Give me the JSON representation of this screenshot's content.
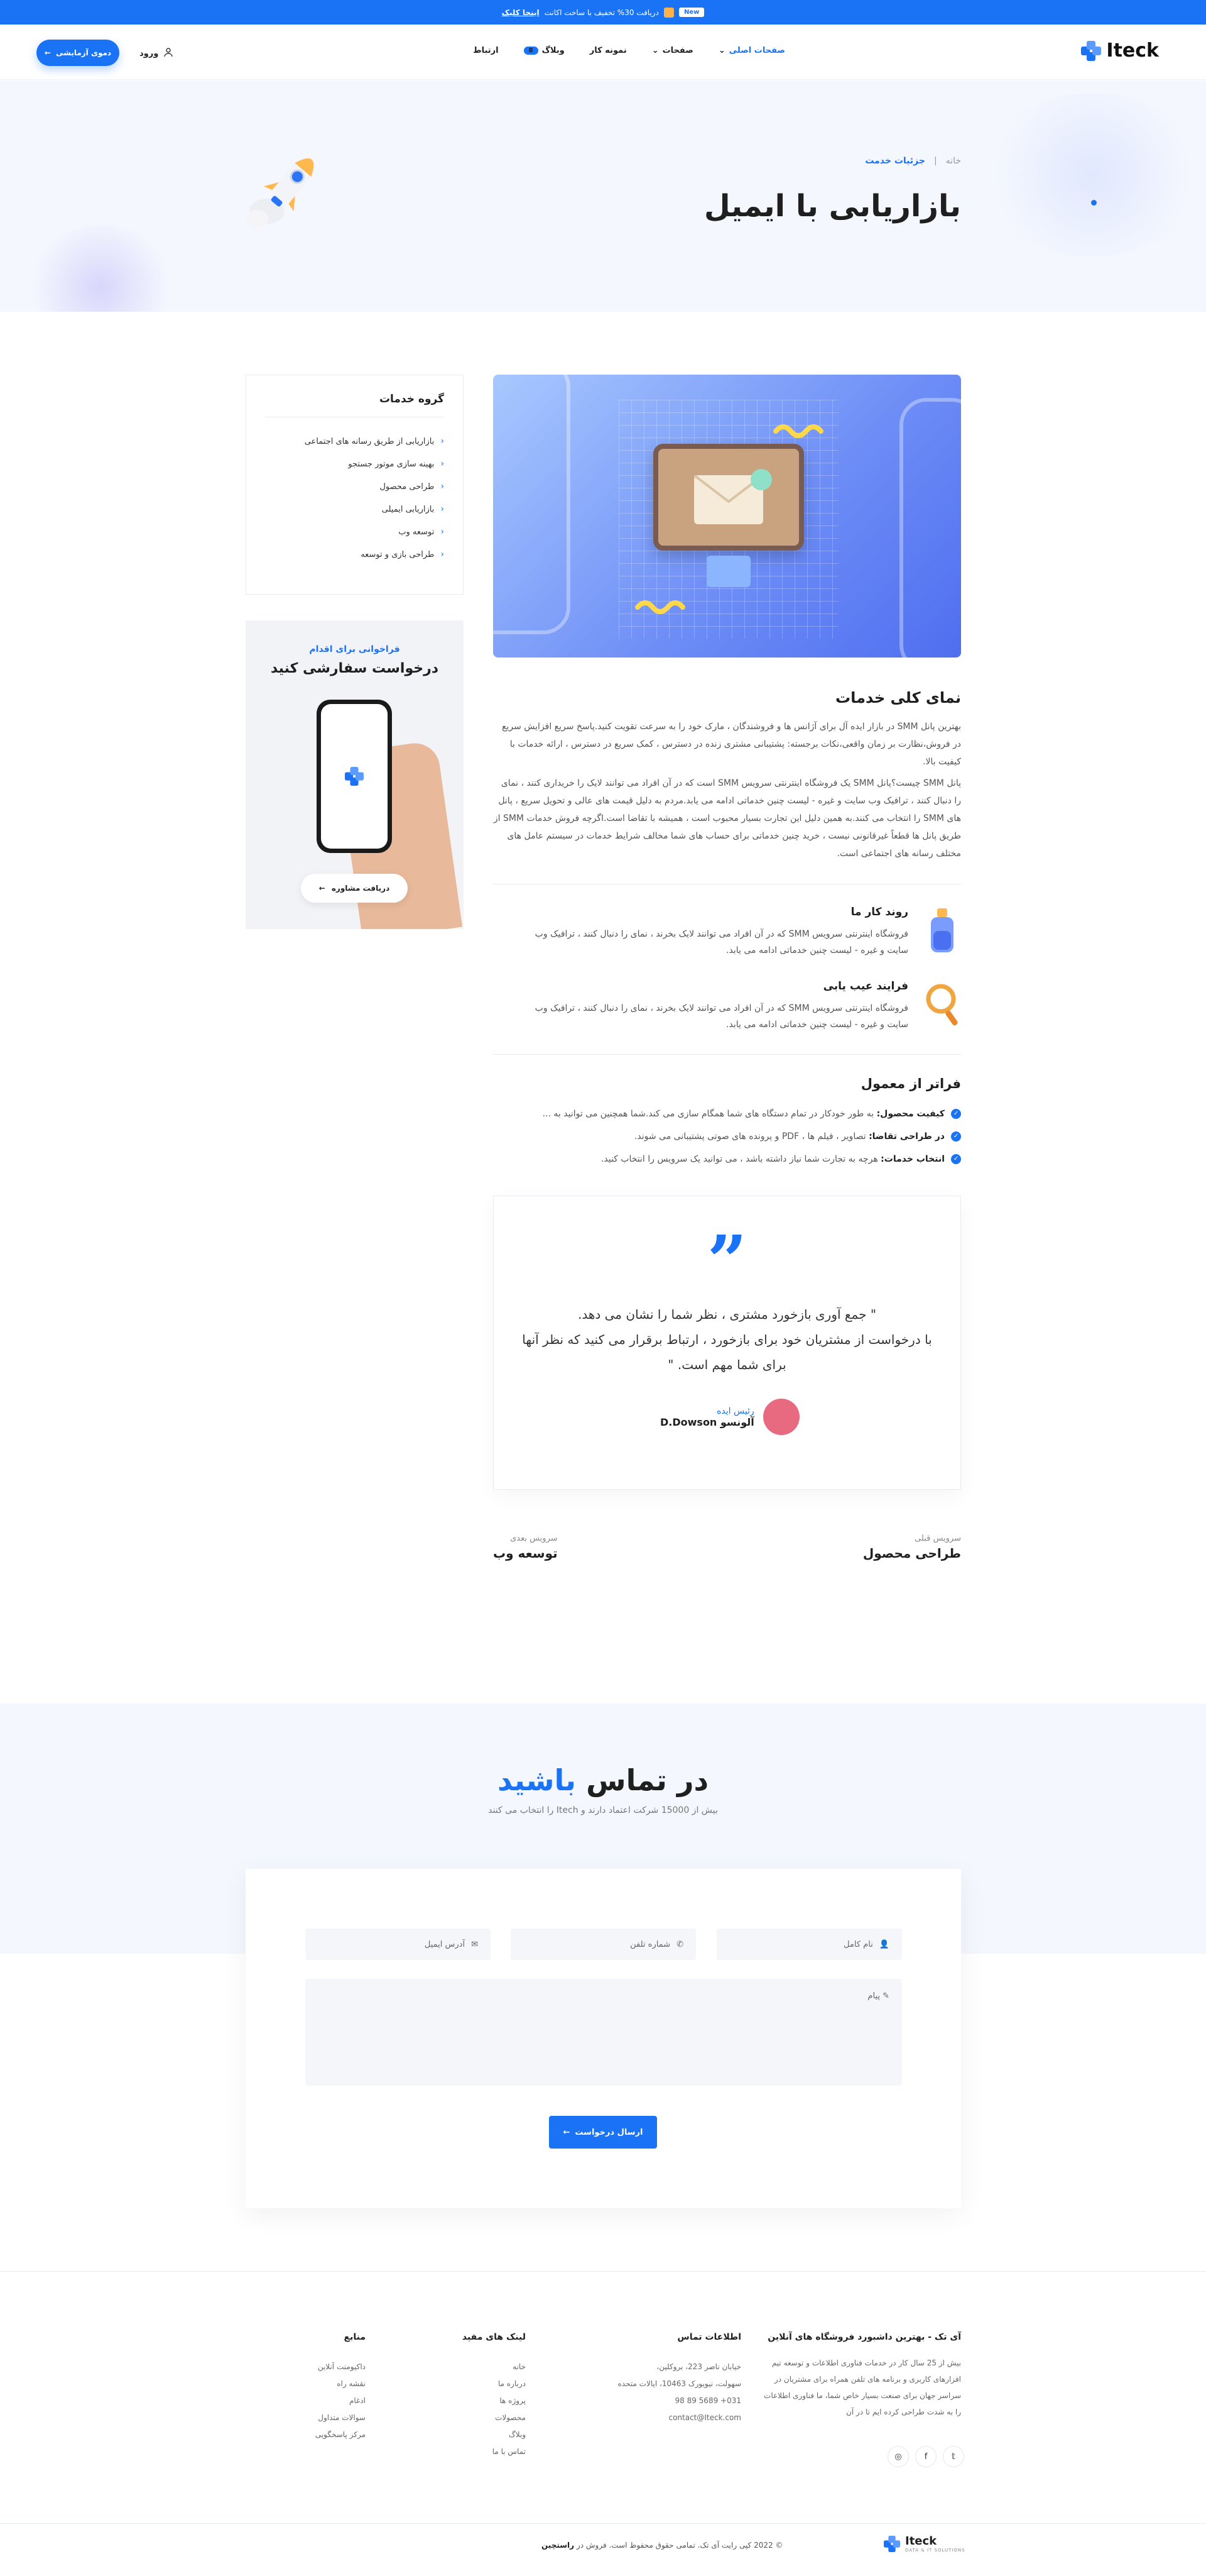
{
  "topbar": {
    "badge": "New",
    "text": "دریافت 30% تخفیف با ساخت اکانت",
    "link": "اینجا کلیک"
  },
  "header": {
    "logo": "Iteck",
    "menu": [
      {
        "label": "صفحات اصلی",
        "has_dropdown": true,
        "active": true
      },
      {
        "label": "صفحات",
        "has_dropdown": true
      },
      {
        "label": "نمونه کار",
        "has_dropdown": true
      },
      {
        "label": "وبلاگ",
        "badge": "8"
      },
      {
        "label": "ارتباط"
      }
    ],
    "login": "ورود",
    "cta": "دموی آزمایشی"
  },
  "hero": {
    "breadcrumb_home": "خانه",
    "breadcrumb_current": "جزئیات خدمت",
    "title": "بازاریابی با ایمیل"
  },
  "sidebar": {
    "title": "گروه خدمات",
    "items": [
      "بازاریابی از طریق رسانه های اجتماعی",
      "بهینه سازی موتور جستجو",
      "طراحی محصول",
      "بازاریابی ایمیلی",
      "توسعه وب",
      "طراحی بازی و توسعه"
    ]
  },
  "cta_card": {
    "kicker": "فراخوانی برای اقدام",
    "title": "درخواست سفارشی کنید",
    "button": "دریافت مشاوره"
  },
  "overview": {
    "title": "نمای کلی خدمات",
    "p1": "بهترین پانل SMM در بازار ایده آل برای آژانس ها و فروشندگان ، مارک خود را به سرعت تقویت کنید.پاسخ سریع افزایش سریع در فروش،نظارت بر زمان واقعی،نکات برجسته: پشتیبانی مشتری زنده در دسترس ، کمک سریع در دسترس ، ارائه خدمات با کیفیت بالا.",
    "p2": "پانل SMM چیست؟پانل SMM یک فروشگاه اینترنتی سرویس SMM است که در آن افراد می توانند لایک را خریداری کنند ، نمای را دنبال کنند ، ترافیک وب سایت و غیره - لیست چنین خدماتی ادامه می یابد.مردم به دلیل قیمت های عالی و تحویل سریع ، پانل های SMM را انتخاب می کنند.به همین دلیل این تجارت بسیار محبوب است ، همیشه با تقاضا است.اگرچه فروش خدمات SMM از طریق پانل ها قطعاً غیرقانونی نیست ، خرید چنین خدماتی برای حساب های شما مخالف شرایط خدمات در سیستم عامل های مختلف رسانه های اجتماعی است."
  },
  "processes": [
    {
      "title": "روند کار ما",
      "text": "فروشگاه اینترنتی سرویس SMM که در آن افراد می توانند لایک بخرند ، نمای را دنبال کنند ، ترافیک وب سایت و غیره - لیست چنین خدماتی ادامه می یابد."
    },
    {
      "title": "فرایند عیب یابی",
      "text": "فروشگاه اینترنتی سرویس SMM که در آن افراد می توانند لایک بخرند ، نمای را دنبال کنند ، ترافیک وب سایت و غیره - لیست چنین خدماتی ادامه می یابد."
    }
  ],
  "features": {
    "title": "فراتر از معمول",
    "items": [
      {
        "bold": "کیفیت محصول:",
        "text": " به طور خودکار در تمام دستگاه های شما همگام سازی می کند.شما همچنین می توانید به ..."
      },
      {
        "bold": "در طراحی تقاضا:",
        "text": " تصاویر ، فیلم ها ، PDF و پرونده های صوتی پشتیبانی می شوند."
      },
      {
        "bold": "انتخاب خدمات:",
        "text": " هرچه به تجارت شما نیاز داشته باشد ، می توانید یک سرویس را انتخاب کنید."
      }
    ]
  },
  "testimonial": {
    "line1": "\" جمع آوری بازخورد مشتری ، نظر شما را نشان می دهد.",
    "line2": "با درخواست از مشتریان خود برای بازخورد ، ارتباط برقرار می کنید که نظر آنها",
    "line3": "برای شما مهم است. \"",
    "role": "رئیس ایده",
    "name": "آلونسو D.Dowson"
  },
  "nav_services": {
    "prev_label": "سرویس قبلی",
    "prev_title": "طراحی محصول",
    "next_label": "سرویس بعدی",
    "next_title": "توسعه وب"
  },
  "contact": {
    "title_a": "در تماس",
    "title_b": "باشید",
    "subtitle": "بیش از 15000 شرکت اعتماد دارند و Itech را انتخاب می کنند",
    "name_placeholder": "نام کامل",
    "phone_placeholder": "شماره تلفن",
    "email_placeholder": "آدرس ایمیل",
    "message_placeholder": "پیام",
    "submit": "ارسال درخواست"
  },
  "footer": {
    "about_title": "آی تک - بهترین داشبورد فروشگاه های آنلاین",
    "about_text": "بیش از 25 سال کار در خدمات فناوری اطلاعات و توسعه تیم افزارهای کاربری و برنامه های تلفن همراه برای مشتریان در سراسر جهان برای صنعت بسیار خاص شما، ما فناوری اطلاعات را به شدت طراحی کرده ایم تا در آن",
    "contact_title": "اطلاعات تماس",
    "contact_lines": [
      "خیابان ناصر 223، بروکلین،",
      "سهولت، نیویورک 10463، ایالات متحده",
      "031+ 5689 89 98",
      "contact@Iteck.com"
    ],
    "links_title": "لینک های مفید",
    "links": [
      "خانه",
      "درباره ما",
      "پروژه ها",
      "محصولات",
      "وبلاگ",
      "تماس با ما"
    ],
    "resources_title": "منابع",
    "resources": [
      "داکیومنت آنلاین",
      "نقشه راه",
      "ادغام",
      "سوالات متداول",
      "مرکز پاسخگویی"
    ],
    "social": [
      "twitter-icon",
      "facebook-icon",
      "instagram-icon"
    ],
    "copyright": "© 2022 کپی رایت آی تک. تمامی حقوق محفوظ است. فروش در",
    "copyright_link": "راستچین",
    "logo": "Iteck",
    "logo_tag": "DATA & IT SOLUTIONS"
  },
  "colors": {
    "accent": "#1a73f5",
    "hero_bg": "#f4f7fe"
  }
}
